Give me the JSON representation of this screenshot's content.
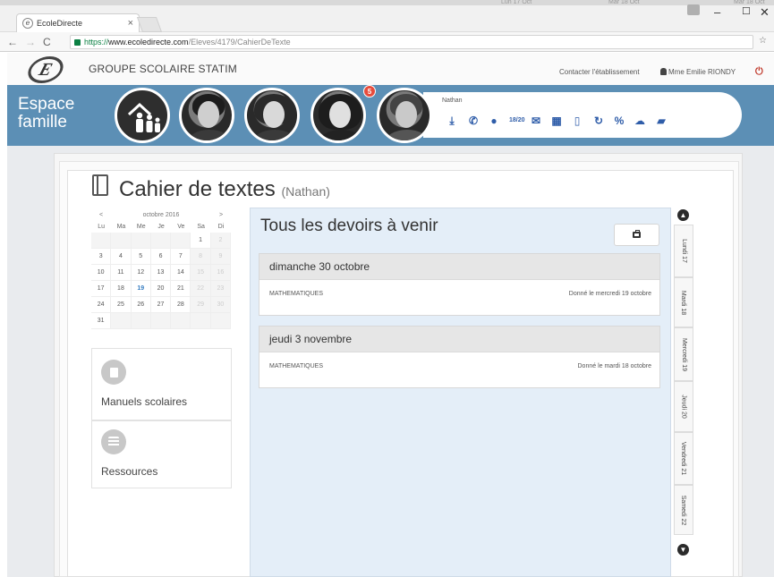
{
  "browser": {
    "tab_title": "EcoleDirecte",
    "tab_close": "×",
    "url_scheme": "https://",
    "url_host": "www.ecoledirecte.com",
    "url_path": "/Eleves/4179/CahierDeTexte",
    "top_cal": [
      "Lun 17 Oct",
      "Mar 18 Oct",
      "Mar 18 Oct"
    ],
    "window_min": "–",
    "window_max": "☐",
    "window_close": "✕"
  },
  "header": {
    "logo_letter": "E",
    "school_name": "GROUPE SCOLAIRE STATIM",
    "contact_label": "Contacter l'établissement",
    "user_label": "Mme Emilie RIONDY"
  },
  "banner": {
    "espace_line1": "Espace",
    "espace_line2": "famille",
    "notification_count": "5",
    "child_name": "Nathan"
  },
  "page": {
    "title": "Cahier de textes",
    "child": "(Nathan)"
  },
  "calendar": {
    "prev": "<",
    "month": "octobre 2016",
    "next": ">",
    "dow": [
      "Lu",
      "Ma",
      "Me",
      "Je",
      "Ve",
      "Sa",
      "Di"
    ],
    "today": "19"
  },
  "cards": {
    "manuels": "Manuels scolaires",
    "ressources": "Ressources"
  },
  "main": {
    "title": "Tous les devoirs à venir",
    "homework": [
      {
        "date": "dimanche 30 octobre",
        "subject": "MATHEMATIQUES",
        "given": "Donné le mercredi 19 octobre"
      },
      {
        "date": "jeudi 3 novembre",
        "subject": "MATHEMATIQUES",
        "given": "Donné le mardi 18 octobre"
      }
    ]
  },
  "daytabs": [
    "Lundi 17",
    "Mardi 18",
    "Mercredi 19",
    "Jeudi 20",
    "Vendredi 21",
    "Samedi 22"
  ]
}
